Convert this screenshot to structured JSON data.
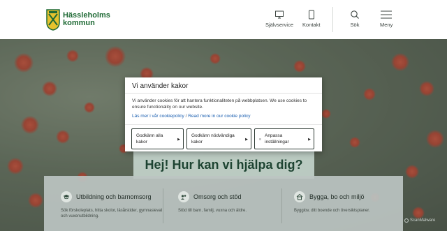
{
  "header": {
    "logo_line1": "Hässleholms",
    "logo_line2": "kommun",
    "nav": [
      {
        "label": "Självservice",
        "icon": "monitor-icon"
      },
      {
        "label": "Kontakt",
        "icon": "phone-icon"
      },
      {
        "label": "Sök",
        "icon": "search-icon"
      },
      {
        "label": "Meny",
        "icon": "hamburger-icon"
      }
    ]
  },
  "hero": {
    "heading": "Hej! Hur kan vi hjälpa dig?"
  },
  "services": [
    {
      "title": "Utbildning och barnomsorg",
      "desc": "Sök förskoleplats, hitta skolor, läsårstider, gymnasieval och vuxenutbildning.",
      "icon": "graduation-cap-icon"
    },
    {
      "title": "Omsorg och stöd",
      "desc": "Stöd till barn, familj, vuxna och äldre.",
      "icon": "support-icon"
    },
    {
      "title": "Bygga, bo och miljö",
      "desc": "Bygglov, ditt boende och översiktsplaner.",
      "icon": "house-icon"
    }
  ],
  "cookie_modal": {
    "title": "Vi använder kakor",
    "body": "Vi använder cookies för att hantera funktionaliteten på webbplatsen. We use cookies to ensure functionality on our website.",
    "link1": "Läs mer i vår cookiepolicy",
    "link_sep": "/",
    "link2": "Read more in our cookie policy",
    "buttons": [
      {
        "label": "Godkänn alla kakor"
      },
      {
        "label": "Godkänn nödvändiga kakor"
      },
      {
        "label": "Anpassa inställningar"
      }
    ]
  },
  "watermark": "ScanMalware",
  "colors": {
    "brand_green": "#1f6a35",
    "link_blue": "#1b5fb0"
  }
}
